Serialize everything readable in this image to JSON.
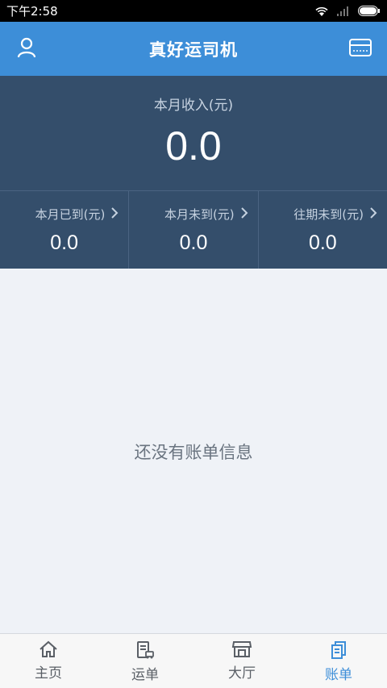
{
  "status_bar": {
    "time": "下午2:58"
  },
  "header": {
    "title": "真好运司机",
    "profile_icon": "user-icon",
    "card_icon": "credit-card-icon"
  },
  "summary": {
    "month_income_label": "本月收入(元)",
    "month_income_value": "0.0",
    "stats": [
      {
        "label": "本月已到(元)",
        "value": "0.0"
      },
      {
        "label": "本月未到(元)",
        "value": "0.0"
      },
      {
        "label": "往期未到(元)",
        "value": "0.0"
      }
    ]
  },
  "empty_state": {
    "message": "还没有账单信息"
  },
  "bottom_nav": {
    "items": [
      {
        "label": "主页",
        "icon": "home-icon"
      },
      {
        "label": "运单",
        "icon": "waybill-icon"
      },
      {
        "label": "大厅",
        "icon": "hall-icon"
      },
      {
        "label": "账单",
        "icon": "bill-icon",
        "active": true
      }
    ]
  },
  "colors": {
    "header_blue": "#3d8ed8",
    "summary_bg": "#344e6b",
    "page_bg": "#eff2f7"
  }
}
